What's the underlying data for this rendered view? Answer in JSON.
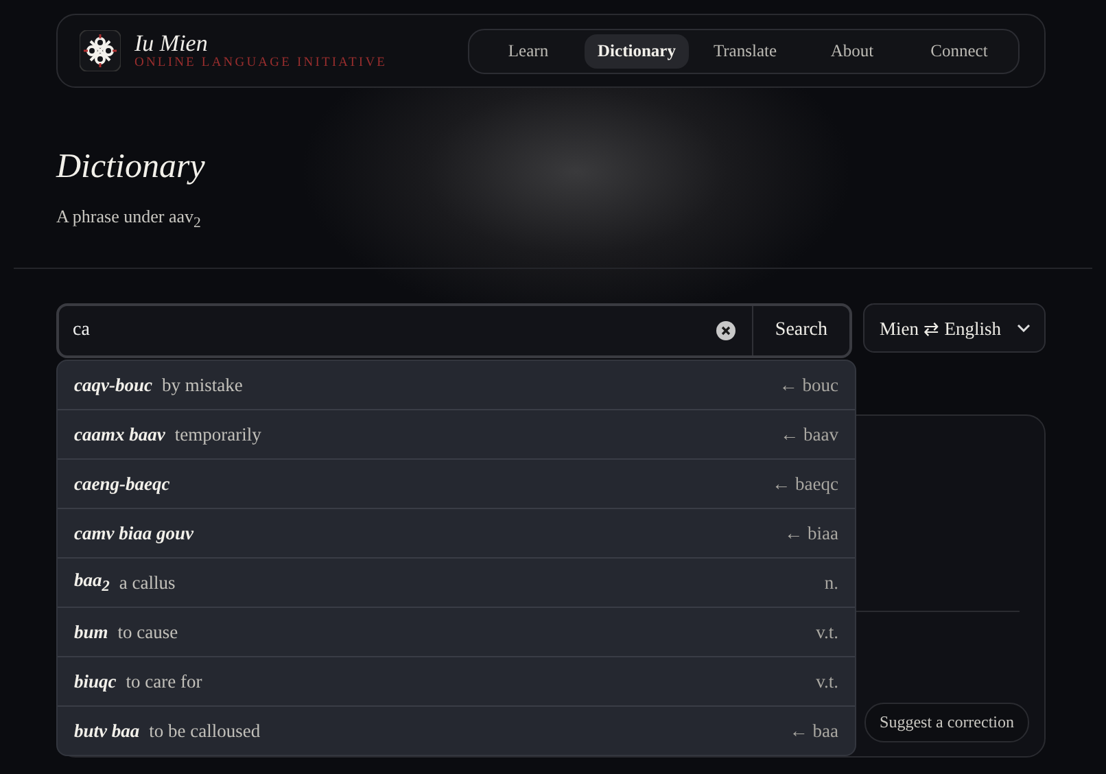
{
  "brand": {
    "name": "Iu Mien",
    "tagline": "ONLINE LANGUAGE INITIATIVE"
  },
  "nav": [
    {
      "label": "Learn",
      "selected": false
    },
    {
      "label": "Dictionary",
      "selected": true
    },
    {
      "label": "Translate",
      "selected": false
    },
    {
      "label": "About",
      "selected": false
    },
    {
      "label": "Connect",
      "selected": false
    }
  ],
  "page": {
    "title": "Dictionary",
    "subtitle": "A phrase under aav$_{2}$"
  },
  "search": {
    "value": "ca",
    "button": "Search",
    "language": "Mien ⇄ English"
  },
  "suggestions": [
    {
      "headword": "caqv-bouc",
      "gloss": "by mistake",
      "note": "← bouc"
    },
    {
      "headword": "caamx baav",
      "gloss": "temporarily",
      "note": "← baav"
    },
    {
      "headword": "caeng-baeqc",
      "note": "← baeqc"
    },
    {
      "headword": "camv biaa gouv",
      "note": "← biaa"
    },
    {
      "headword": "baa$_{2}$",
      "gloss": "a callus",
      "note": "n."
    },
    {
      "headword": "bum",
      "gloss": "to cause",
      "note": "v.t."
    },
    {
      "headword": "biuqc",
      "gloss": "to care for",
      "note": "v.t."
    },
    {
      "headword": "butv baa",
      "gloss": "to be calloused",
      "note": "← baa"
    }
  ],
  "entry_card": {
    "action": "Suggest a correction"
  }
}
